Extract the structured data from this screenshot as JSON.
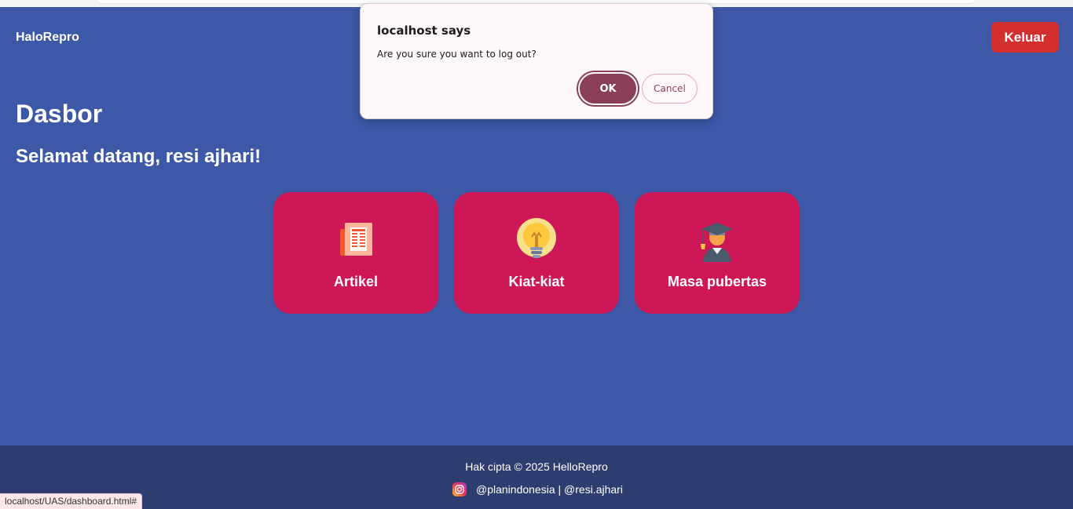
{
  "browser": {
    "status_url": "localhost/UAS/dashboard.html#"
  },
  "navbar": {
    "brand": "HaloRepro",
    "logout_label": "Keluar"
  },
  "main": {
    "title": "Dasbor",
    "welcome": "Selamat datang, resi ajhari!",
    "cards": [
      {
        "label": "Artikel",
        "icon": "newspaper-icon"
      },
      {
        "label": "Kiat-kiat",
        "icon": "lightbulb-icon"
      },
      {
        "label": "Masa pubertas",
        "icon": "graduate-student-icon"
      }
    ]
  },
  "footer": {
    "copyright": "Hak cipta © 2025 HelloRepro",
    "social_icon": "instagram-icon",
    "handles": "@planindonesia | @resi.ajhari"
  },
  "dialog": {
    "title": "localhost says",
    "message": "Are you sure you want to log out?",
    "ok_label": "OK",
    "cancel_label": "Cancel"
  },
  "colors": {
    "page_background": "#3d58a7",
    "card_background": "#cd1756",
    "logout_button": "#d32f2f",
    "footer_background": "#2e3d6f",
    "dialog_ok": "#8b3f57"
  }
}
